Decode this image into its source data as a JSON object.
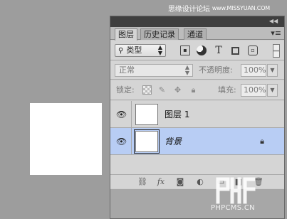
{
  "watermark": {
    "top_text": "思缘设计论坛",
    "top_url": "www.MISSYUAN.COM",
    "bottom_text": "PHPCMS.CN"
  },
  "panel": {
    "tabs": [
      {
        "label": "图层",
        "active": true
      },
      {
        "label": "历史记录",
        "active": false
      },
      {
        "label": "通道",
        "active": false
      }
    ],
    "tab_menu_icon": "≡",
    "collapse_icon": "double-chevron-icon",
    "filter": {
      "kind_label": "类型",
      "kind_icon": "search-icon"
    },
    "blend": {
      "mode": "正常",
      "opacity_label": "不透明度:",
      "opacity_value": "100%"
    },
    "lock": {
      "label": "锁定:",
      "fill_label": "填充:",
      "fill_value": "100%"
    },
    "layers": [
      {
        "name": "图层 1",
        "selected": false,
        "locked": false
      },
      {
        "name": "背景",
        "selected": true,
        "locked": true
      }
    ],
    "bottom_icons": [
      "link-icon",
      "fx-icon",
      "mask-icon",
      "adjustment-icon",
      "group-folder-icon",
      "new-layer-icon",
      "trash-icon"
    ]
  }
}
